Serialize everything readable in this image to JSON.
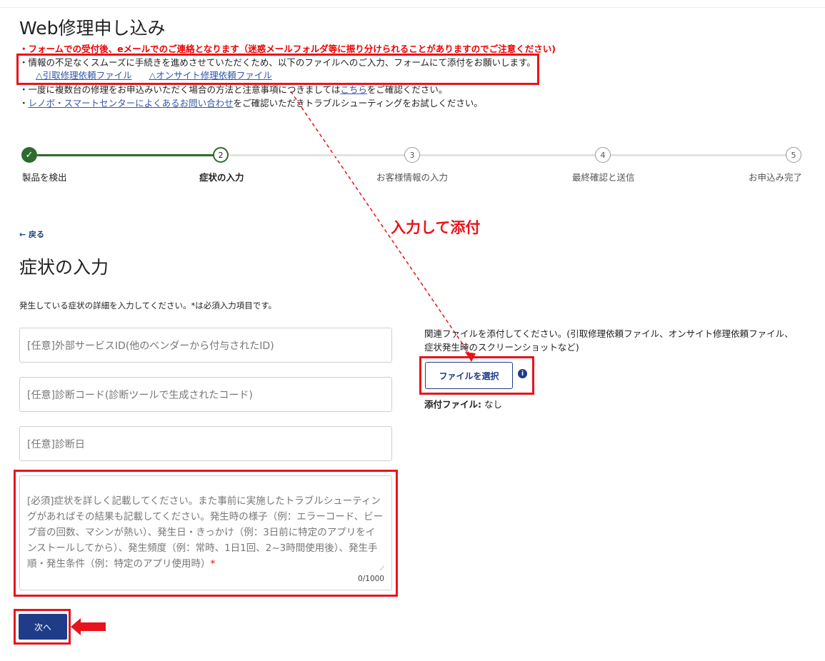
{
  "page_title": "Web修理申し込み",
  "notices": {
    "red": "・フォームでの受付後、eメールでのご連絡となります（迷惑メールフォルダ等に振り分けられることがありますのでご注意ください)",
    "line2": "・情報の不足なくスムーズに手続きを進めさせていただくため、以下のファイルへのご入力、フォームにて添付をお願いします。",
    "link1": "△引取修理依頼ファイル",
    "link2": "△オンサイト修理依頼ファイル",
    "line3_prefix": "・一度に複数台の修理をお申込みいただく場合の方法と注意事項につきましては",
    "line3_link": "こちら",
    "line3_suffix": "をご確認ください。",
    "line4_prefix": "・",
    "line4_link": "レノボ・スマートセンターによくあるお問い合わせ",
    "line4_suffix": "をご確認いただきトラブルシューティングをお試しください。"
  },
  "stepper": {
    "steps": [
      {
        "number": "",
        "label": "製品を検出",
        "state": "done"
      },
      {
        "number": "2",
        "label": "症状の入力",
        "state": "current"
      },
      {
        "number": "3",
        "label": "お客様情報の入力",
        "state": "todo"
      },
      {
        "number": "4",
        "label": "最終確認と送信",
        "state": "todo"
      },
      {
        "number": "5",
        "label": "お申込み完了",
        "state": "todo"
      }
    ],
    "check_glyph": "✓"
  },
  "back_link": "← 戻る",
  "section_title": "症状の入力",
  "section_desc": "発生している症状の詳細を入力してください。*は必須入力項目です。",
  "fields": {
    "external_id": "[任意]外部サービスID(他のベンダーから付与されたID)",
    "diag_code": "[任意]診断コード(診断ツールで生成されたコード)",
    "diag_date": "[任意]診断日",
    "symptom": "[必須]症状を詳しく記載してください。また事前に実施したトラブルシューティングがあればその結果も記載してください。発生時の様子（例：エラーコード、ビープ音の回数、マシンが熱い）、発生日・きっかけ（例：3日前に特定のアプリをインストールしてから）、発生頻度（例：常時、1日1回、2~3時間使用後）、発生手順・発生条件（例：特定のアプリ使用時）",
    "required_mark": "*",
    "counter": "0/1000"
  },
  "next_button": "次へ",
  "annotation": "入力して添付",
  "attachment": {
    "desc": "関連ファイルを添付してください。(引取修理依頼ファイル、オンサイト修理依頼ファイル、症状発生時のスクリーンショットなど)",
    "button": "ファイルを選択",
    "info_glyph": "i",
    "attached_label": "添付ファイル:",
    "attached_value": "なし"
  },
  "colors": {
    "accent": "#1f3c88",
    "done_green": "#2e6b2e",
    "highlight_red": "#e8141b",
    "notice_red": "#ee0000"
  }
}
